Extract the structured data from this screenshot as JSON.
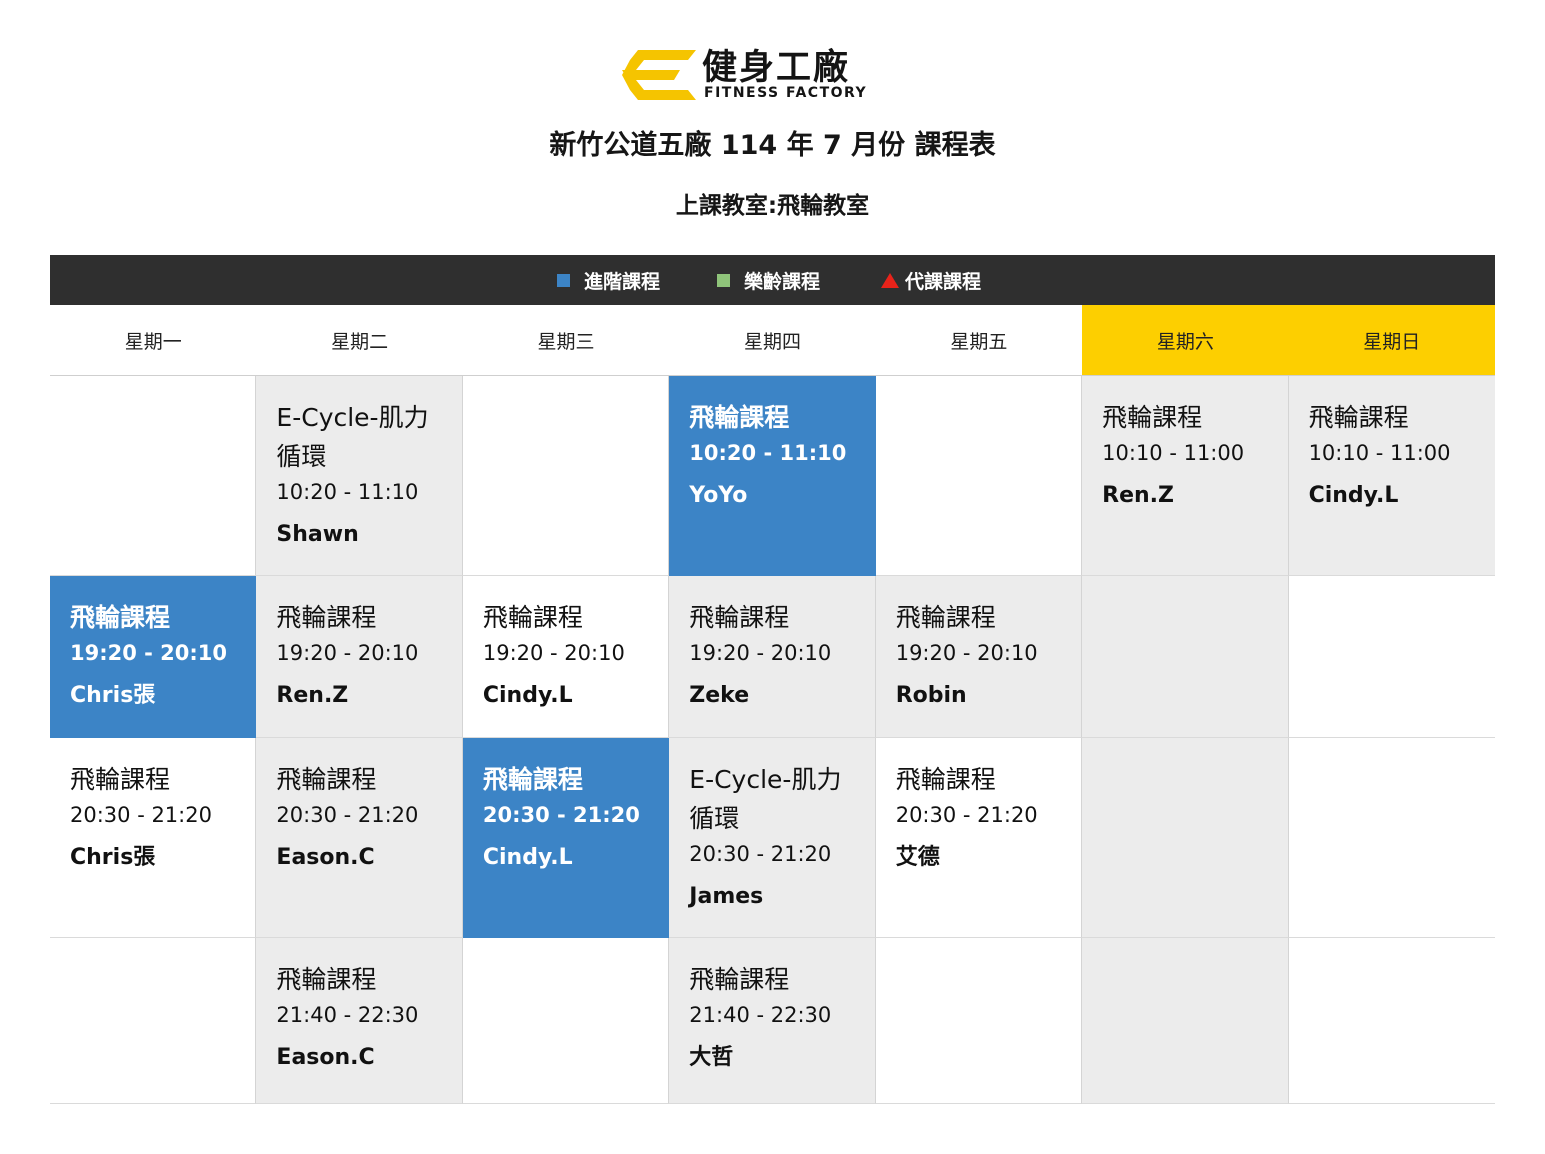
{
  "brand": {
    "name_cn": "健身工廠",
    "name_en": "FITNESS FACTORY",
    "logo_color": "#f5c400"
  },
  "title": "新竹公道五廠 114 年 7 月份 課程表",
  "room": "上課教室:飛輪教室",
  "legend": [
    {
      "label": "進階課程",
      "color": "#3c84c6",
      "icon": "blue-square-icon"
    },
    {
      "label": "樂齡課程",
      "color": "#8fc47a",
      "icon": "green-square-icon"
    },
    {
      "label": "代課課程",
      "color": "#e8231a",
      "icon": "red-triangle-icon"
    }
  ],
  "days": [
    {
      "label": "星期一",
      "weekend": false
    },
    {
      "label": "星期二",
      "weekend": false
    },
    {
      "label": "星期三",
      "weekend": false
    },
    {
      "label": "星期四",
      "weekend": false
    },
    {
      "label": "星期五",
      "weekend": false
    },
    {
      "label": "星期六",
      "weekend": true
    },
    {
      "label": "星期日",
      "weekend": true
    }
  ],
  "rows": [
    [
      null,
      {
        "name": "E-Cycle-肌力循環",
        "time": "10:20 - 11:10",
        "instructor": "Shawn",
        "type": "normal"
      },
      null,
      {
        "name": "飛輪課程",
        "time": "10:20 - 11:10",
        "instructor": "YoYo",
        "type": "advanced"
      },
      null,
      {
        "name": "飛輪課程",
        "time": "10:10 - 11:00",
        "instructor": "Ren.Z",
        "type": "normal"
      },
      {
        "name": "飛輪課程",
        "time": "10:10 - 11:00",
        "instructor": "Cindy.L",
        "type": "normal"
      }
    ],
    [
      {
        "name": "飛輪課程",
        "time": "19:20 - 20:10",
        "instructor": "Chris張",
        "type": "advanced"
      },
      {
        "name": "飛輪課程",
        "time": "19:20 - 20:10",
        "instructor": "Ren.Z",
        "type": "normal"
      },
      {
        "name": "飛輪課程",
        "time": "19:20 - 20:10",
        "instructor": "Cindy.L",
        "type": "normal"
      },
      {
        "name": "飛輪課程",
        "time": "19:20 - 20:10",
        "instructor": "Zeke",
        "type": "normal"
      },
      {
        "name": "飛輪課程",
        "time": "19:20 - 20:10",
        "instructor": "Robin",
        "type": "normal"
      },
      null,
      null
    ],
    [
      {
        "name": "飛輪課程",
        "time": "20:30 - 21:20",
        "instructor": "Chris張",
        "type": "normal"
      },
      {
        "name": "飛輪課程",
        "time": "20:30 - 21:20",
        "instructor": "Eason.C",
        "type": "normal"
      },
      {
        "name": "飛輪課程",
        "time": "20:30 - 21:20",
        "instructor": "Cindy.L",
        "type": "advanced"
      },
      {
        "name": "E-Cycle-肌力循環",
        "time": "20:30 - 21:20",
        "instructor": "James",
        "type": "normal"
      },
      {
        "name": "飛輪課程",
        "time": "20:30 - 21:20",
        "instructor": "艾德",
        "type": "normal"
      },
      null,
      null
    ],
    [
      null,
      {
        "name": "飛輪課程",
        "time": "21:40 - 22:30",
        "instructor": "Eason.C",
        "type": "normal"
      },
      null,
      {
        "name": "飛輪課程",
        "time": "21:40 - 22:30",
        "instructor": "大哲",
        "type": "normal"
      },
      null,
      null,
      null
    ]
  ]
}
